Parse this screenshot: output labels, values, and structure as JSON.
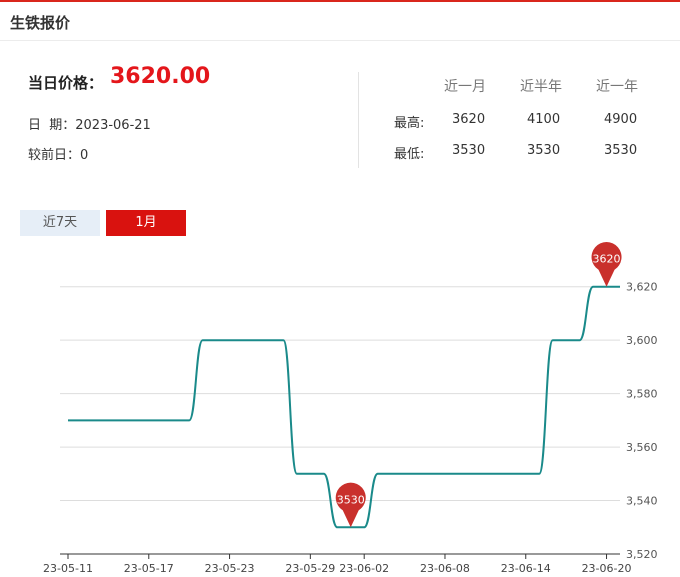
{
  "header": {
    "title": "生铁报价"
  },
  "summary": {
    "price_label": "当日价格：",
    "price": "3620.00",
    "date_label": "日  期：",
    "date": "2023-06-21",
    "change_label": "较前日：",
    "change": "0"
  },
  "stats": {
    "columns": [
      "近一月",
      "近半年",
      "近一年"
    ],
    "rows": [
      {
        "label": "最高:",
        "values": [
          "3620",
          "4100",
          "4900"
        ]
      },
      {
        "label": "最低:",
        "values": [
          "3530",
          "3530",
          "3530"
        ]
      }
    ]
  },
  "tabs": [
    {
      "label": "近7天",
      "active": false
    },
    {
      "label": "1月",
      "active": true
    }
  ],
  "colors": {
    "accent": "#e4161b",
    "line": "#1a8a8a",
    "marker": "#c9302c"
  },
  "chart_data": {
    "type": "line",
    "x": [
      "23-05-11",
      "23-05-12",
      "23-05-13",
      "23-05-14",
      "23-05-15",
      "23-05-16",
      "23-05-17",
      "23-05-18",
      "23-05-19",
      "23-05-20",
      "23-05-21",
      "23-05-22",
      "23-05-23",
      "23-05-24",
      "23-05-25",
      "23-05-26",
      "23-05-27",
      "23-05-28",
      "23-05-29",
      "23-05-30",
      "23-05-31",
      "23-06-01",
      "23-06-02",
      "23-06-03",
      "23-06-04",
      "23-06-05",
      "23-06-06",
      "23-06-07",
      "23-06-08",
      "23-06-09",
      "23-06-10",
      "23-06-11",
      "23-06-12",
      "23-06-13",
      "23-06-14",
      "23-06-15",
      "23-06-16",
      "23-06-17",
      "23-06-18",
      "23-06-19",
      "23-06-20",
      "23-06-21"
    ],
    "values": [
      3570,
      3570,
      3570,
      3570,
      3570,
      3570,
      3570,
      3570,
      3570,
      3570,
      3600,
      3600,
      3600,
      3600,
      3600,
      3600,
      3600,
      3550,
      3550,
      3550,
      3530,
      3530,
      3530,
      3550,
      3550,
      3550,
      3550,
      3550,
      3550,
      3550,
      3550,
      3550,
      3550,
      3550,
      3550,
      3550,
      3600,
      3600,
      3600,
      3620,
      3620,
      3620
    ],
    "xticks": [
      "23-05-11",
      "23-05-17",
      "23-05-23",
      "23-05-29",
      "23-06-02",
      "23-06-08",
      "23-06-14",
      "23-06-20"
    ],
    "yticks": [
      3520,
      3540,
      3560,
      3580,
      3600,
      3620
    ],
    "ylim": [
      3520,
      3630
    ],
    "markers": [
      {
        "label": "3620",
        "x": "23-06-20",
        "y": 3620
      },
      {
        "label": "3530",
        "x": "23-06-01",
        "y": 3530
      }
    ],
    "grid": true
  }
}
